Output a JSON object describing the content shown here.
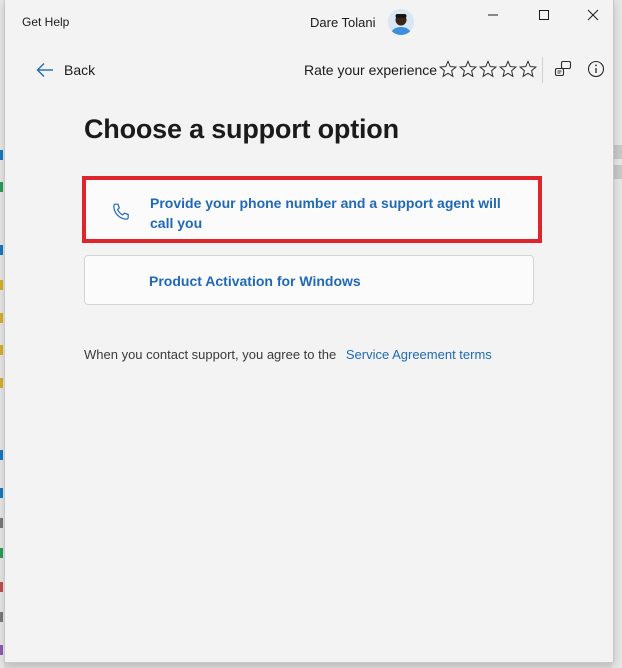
{
  "window": {
    "app_title": "Get Help",
    "user_name": "Dare Tolani"
  },
  "toolbar": {
    "back_label": "Back",
    "rate_label": "Rate your experience",
    "stars": 5
  },
  "main": {
    "title": "Choose a support option",
    "options": [
      {
        "label": "Provide your phone number and a support agent will call you",
        "icon": "phone-icon",
        "highlighted": true
      },
      {
        "label": "Product Activation for Windows"
      }
    ],
    "agreement_text": "When you contact support, you agree to the",
    "agreement_link": "Service Agreement terms"
  },
  "colors": {
    "accent": "#1f69b5",
    "highlight_border": "#e0242b",
    "window_bg": "#f3f3f3"
  }
}
